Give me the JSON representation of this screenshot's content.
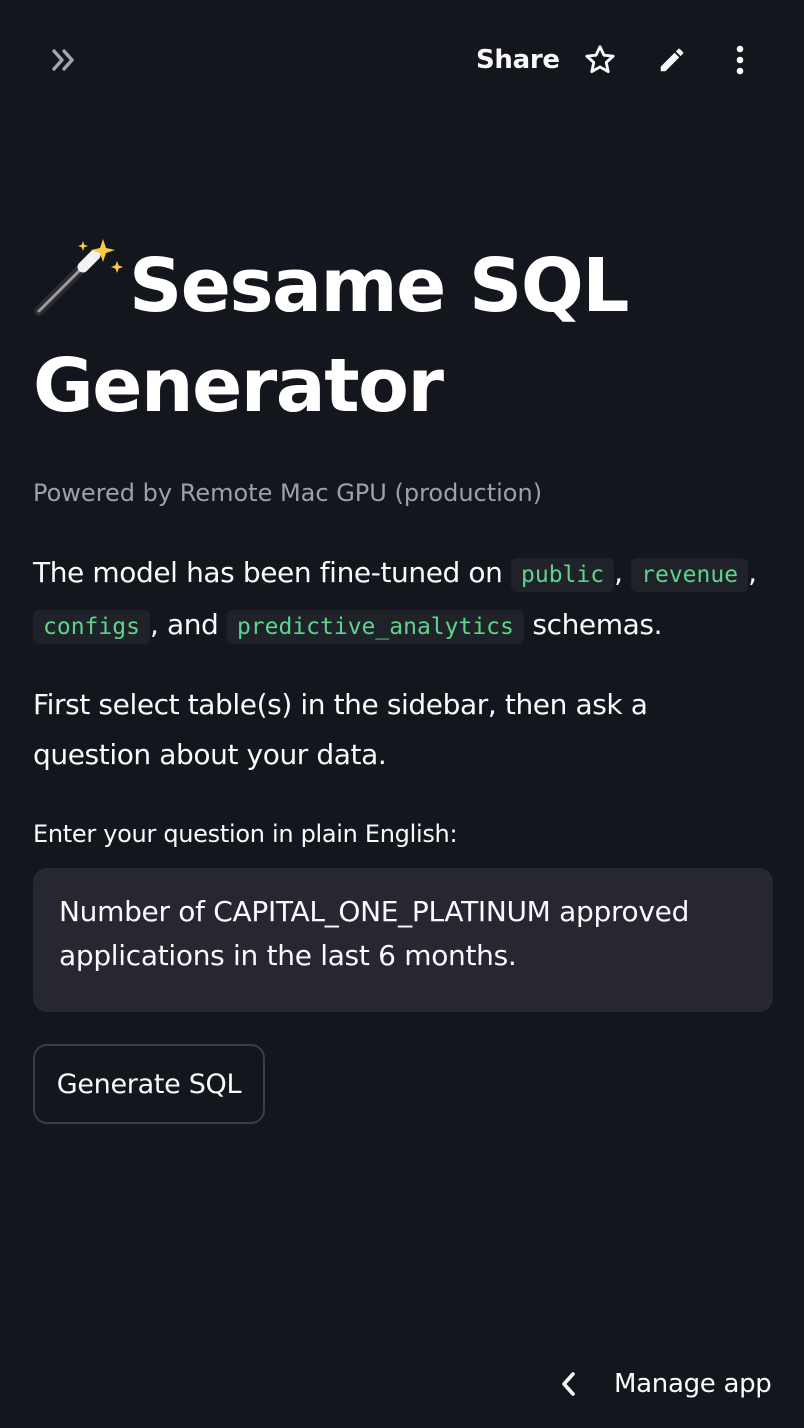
{
  "header": {
    "share_label": "Share",
    "icons": {
      "sidebar_toggle": "double-chevron-right-icon",
      "favorite": "star-icon",
      "edit": "pencil-icon",
      "more": "vertical-dots-icon"
    }
  },
  "page": {
    "title": "Sesame SQL Generator",
    "title_icon": "magic-wand-icon",
    "caption": "Powered by Remote Mac GPU (production)",
    "intro": {
      "prefix": "The model has been fine-tuned on",
      "schemas": [
        "public",
        "revenue",
        "configs",
        "predictive_analytics"
      ],
      "sep1": ",",
      "sep2": ",",
      "and_text": ", and",
      "suffix": "schemas."
    },
    "instruction": "First select table(s) in the sidebar, then ask a question about your data."
  },
  "question": {
    "label": "Enter your question in plain English:",
    "value": "Number of CAPITAL_ONE_PLATINUM approved applications in the last 6 months."
  },
  "actions": {
    "generate_label": "Generate SQL"
  },
  "footer": {
    "manage_label": "Manage app"
  },
  "colors": {
    "background": "#14161d",
    "text": "#fafafa",
    "muted": "#9ea0a7",
    "code_text": "#5fd38d",
    "code_bg": "#1f2229",
    "input_bg": "#262730"
  }
}
